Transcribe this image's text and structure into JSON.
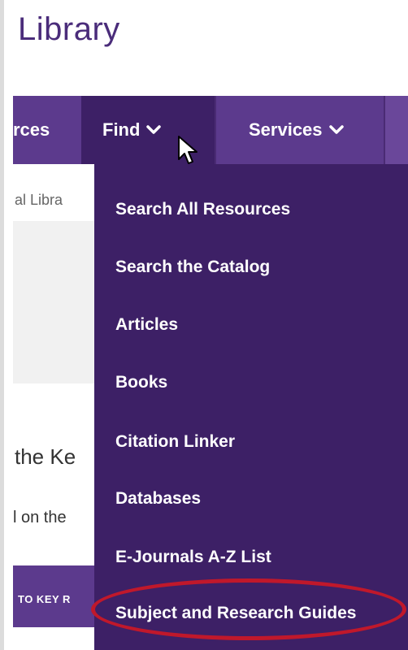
{
  "header": {
    "title": "Library"
  },
  "nav": {
    "resources_label": "rces",
    "find_label": "Find",
    "services_label": "Services"
  },
  "background": {
    "breadcrumb": "al Libra",
    "heading": "the Ke",
    "text": "l on the",
    "band_text": "TO KEY R"
  },
  "dropdown": {
    "items": [
      "Search All Resources",
      "Search the Catalog",
      "Articles",
      "Books",
      "Citation Linker",
      "Databases",
      "E-Journals A-Z List",
      "Subject and Research Guides"
    ]
  },
  "colors": {
    "nav_bg": "#5c3a8d",
    "dropdown_bg": "#3d2066",
    "title": "#4a2c7a",
    "highlight": "#c0182b"
  },
  "icons": [
    "chevron-down-icon",
    "mouse-cursor-icon"
  ]
}
